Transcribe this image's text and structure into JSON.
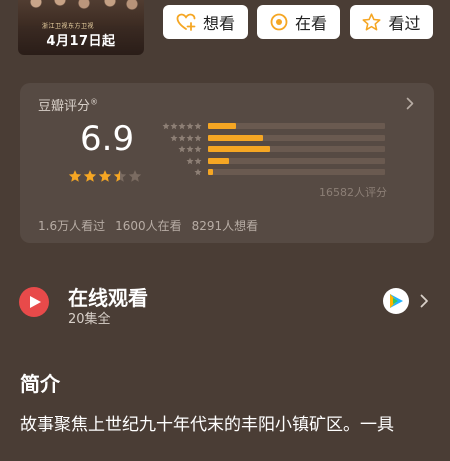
{
  "poster": {
    "tagline": "浙江卫视东方卫视",
    "date": "4月17日起"
  },
  "actions": {
    "want_label": "想看",
    "doing_label": "在看",
    "done_label": "看过"
  },
  "rating": {
    "source": "豆瓣评分",
    "registered_mark": "®",
    "score": "6.9",
    "stars": 3.5,
    "distribution": [
      {
        "stars": 5,
        "percent": 16
      },
      {
        "stars": 4,
        "percent": 31
      },
      {
        "stars": 3,
        "percent": 35
      },
      {
        "stars": 2,
        "percent": 12
      },
      {
        "stars": 1,
        "percent": 3
      }
    ],
    "count_label": "16582人评分",
    "stats": {
      "watched": "1.6万人看过",
      "watching": "1600人在看",
      "want": "8291人想看"
    }
  },
  "watch": {
    "title": "在线观看",
    "episodes": "20集全",
    "play_icon": "play-icon",
    "platform_icon": "tencent-video-icon"
  },
  "intro": {
    "heading": "简介",
    "text": "故事聚焦上世纪九十年代末的丰阳小镇矿区。一具"
  },
  "colors": {
    "background": "#4a3d35",
    "accent": "#f5a623",
    "play": "#e84a4a"
  }
}
